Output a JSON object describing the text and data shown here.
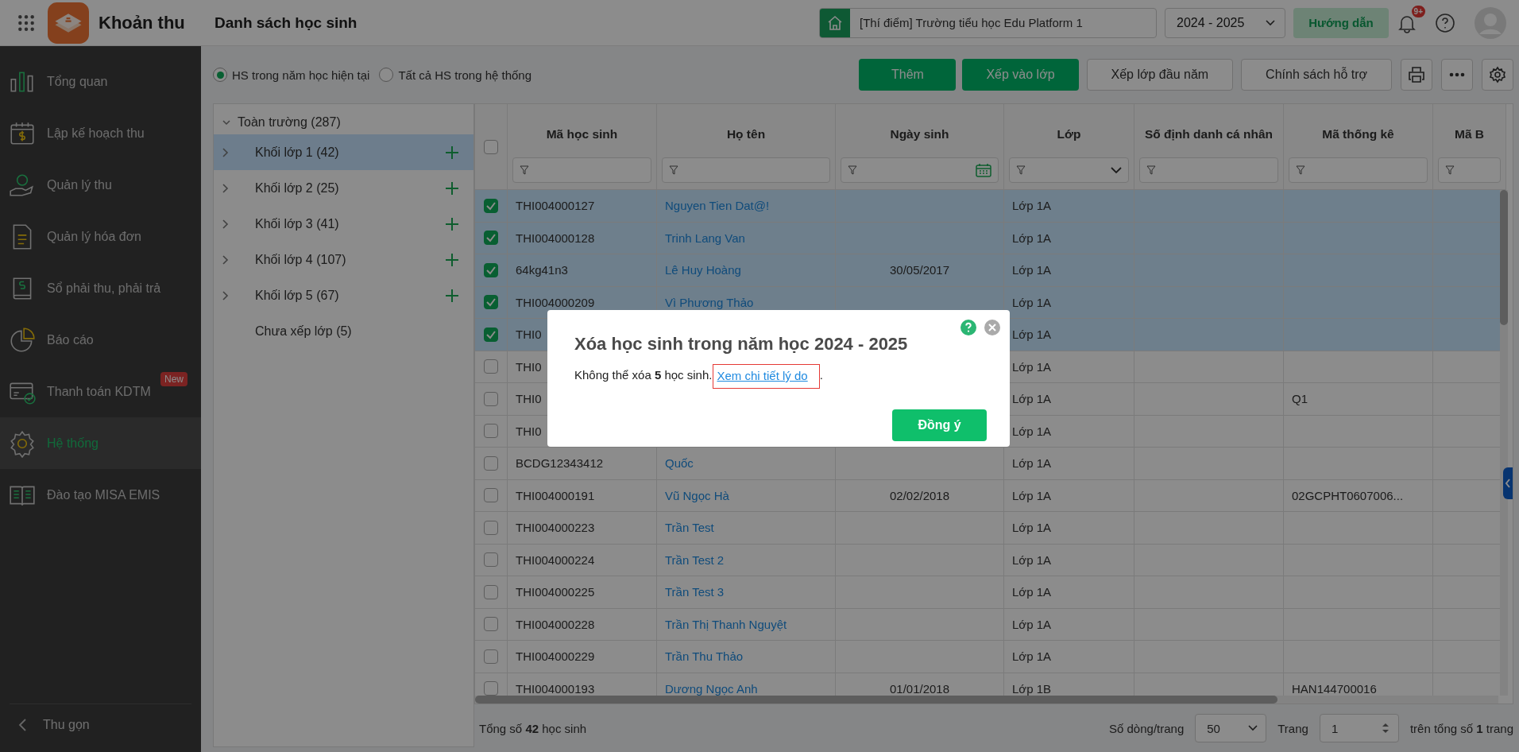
{
  "app": {
    "name": "Khoản thu",
    "page_title": "Danh sách học sinh"
  },
  "header": {
    "school": "[Thí điểm] Trường tiểu học Edu Platform 1",
    "year": "2024 - 2025",
    "guide_button": "Hướng dẫn",
    "notification_badge": "9+"
  },
  "sidebar": {
    "items": [
      {
        "label": "Tổng quan",
        "selected": false
      },
      {
        "label": "Lập kế hoạch thu",
        "selected": false
      },
      {
        "label": "Quản lý thu",
        "selected": false
      },
      {
        "label": "Quản lý hóa đơn",
        "selected": false
      },
      {
        "label": "Sổ phải thu, phải trả",
        "selected": false
      },
      {
        "label": "Báo cáo",
        "selected": false
      },
      {
        "label": "Thanh toán KDTM",
        "selected": false,
        "badge": "New"
      },
      {
        "label": "Hệ thống",
        "selected": true
      },
      {
        "label": "Đào tạo MISA EMIS",
        "selected": false
      }
    ],
    "collapse": "Thu gọn"
  },
  "scope": [
    {
      "label": "HS trong năm học hiện tại",
      "selected": true
    },
    {
      "label": "Tất cả HS trong hệ thống",
      "selected": false
    }
  ],
  "actions": [
    {
      "label": "Thêm",
      "kind": "primary"
    },
    {
      "label": "Xếp vào lớp",
      "kind": "primary"
    },
    {
      "label": "Xếp lớp đầu năm",
      "kind": "outline"
    },
    {
      "label": "Chính sách hỗ trợ",
      "kind": "outline"
    }
  ],
  "tree": {
    "label": "Toàn trường (287)",
    "expanded": true,
    "children": [
      {
        "label": "Khối lớp 1 (42)",
        "kind": "grade",
        "selected": true
      },
      {
        "label": "Khối lớp 2 (25)",
        "kind": "grade",
        "selected": false
      },
      {
        "label": "Khối lớp 3 (41)",
        "kind": "grade",
        "selected": false
      },
      {
        "label": "Khối lớp 4 (107)",
        "kind": "grade",
        "selected": false
      },
      {
        "label": "Khối lớp 5 (67)",
        "kind": "grade",
        "selected": false
      },
      {
        "label": "Chưa xếp lớp (5)",
        "kind": "unassigned",
        "selected": false
      }
    ]
  },
  "table": {
    "all_checked": false,
    "columns": [
      {
        "label": "Mã học sinh",
        "kind": "text"
      },
      {
        "label": "Họ tên",
        "kind": "text"
      },
      {
        "label": "Ngày sinh",
        "kind": "date"
      },
      {
        "label": "Lớp",
        "kind": "select"
      },
      {
        "label": "Số định danh cá nhân",
        "kind": "text"
      },
      {
        "label": "Mã thống kê",
        "kind": "text"
      },
      {
        "label": "Mã B",
        "kind": "text"
      }
    ],
    "rows": [
      {
        "checked": true,
        "cells": [
          "THI004000127",
          "Nguyen Tien Dat@!",
          "",
          "Lớp 1A",
          "",
          "",
          ""
        ]
      },
      {
        "checked": true,
        "cells": [
          "THI004000128",
          "Trinh Lang Van",
          "",
          "Lớp 1A",
          "",
          "",
          ""
        ]
      },
      {
        "checked": true,
        "cells": [
          "64kg41n3",
          "Lê Huy Hoàng",
          "30/05/2017",
          "Lớp 1A",
          "",
          "",
          ""
        ]
      },
      {
        "checked": true,
        "cells": [
          "THI004000209",
          "Vì Phương Thảo",
          "",
          "Lớp 1A",
          "",
          "",
          ""
        ]
      },
      {
        "checked": true,
        "cells": [
          "THI0",
          "",
          "",
          "Lớp 1A",
          "",
          "",
          ""
        ]
      },
      {
        "checked": false,
        "cells": [
          "THI0",
          "",
          "",
          "Lớp 1A",
          "",
          "",
          ""
        ]
      },
      {
        "checked": false,
        "cells": [
          "THI0",
          "",
          "",
          "Lớp 1A",
          "",
          "Q1",
          ""
        ]
      },
      {
        "checked": false,
        "cells": [
          "THI0",
          "",
          "",
          "Lớp 1A",
          "",
          "",
          ""
        ]
      },
      {
        "checked": false,
        "cells": [
          "BCDG12343412",
          "Quốc",
          "",
          "Lớp 1A",
          "",
          "",
          ""
        ]
      },
      {
        "checked": false,
        "cells": [
          "THI004000191",
          "Vũ Ngọc Hà",
          "02/02/2018",
          "Lớp 1A",
          "",
          "02GCPHT0607006...",
          ""
        ]
      },
      {
        "checked": false,
        "cells": [
          "THI004000223",
          "Trần Test",
          "",
          "Lớp 1A",
          "",
          "",
          ""
        ]
      },
      {
        "checked": false,
        "cells": [
          "THI004000224",
          "Trần Test 2",
          "",
          "Lớp 1A",
          "",
          "",
          ""
        ]
      },
      {
        "checked": false,
        "cells": [
          "THI004000225",
          "Trần Test 3",
          "",
          "Lớp 1A",
          "",
          "",
          ""
        ]
      },
      {
        "checked": false,
        "cells": [
          "THI004000228",
          "Trần Thị Thanh Nguyệt",
          "",
          "Lớp 1A",
          "",
          "",
          ""
        ]
      },
      {
        "checked": false,
        "cells": [
          "THI004000229",
          "Trần Thu Thảo",
          "",
          "Lớp 1A",
          "",
          "",
          ""
        ]
      },
      {
        "checked": false,
        "cells": [
          "THI004000193",
          "Dương Ngọc Anh",
          "01/01/2018",
          "Lớp 1B",
          "",
          "HAN144700016",
          ""
        ]
      }
    ]
  },
  "footer": {
    "total": "Tổng số **42** học sinh",
    "page_size_label": "Số dòng/trang",
    "page_size": "50",
    "page_label": "Trang",
    "page": "1",
    "page_total": "trên tổng số **1** trang"
  },
  "dialog": {
    "title": "Xóa học sinh trong năm học 2024 - 2025",
    "message": "Không thể xóa **5** học sinh.",
    "link": "Xem chi tiết lý do",
    "message_end": ".",
    "button": "Đồng ý"
  }
}
